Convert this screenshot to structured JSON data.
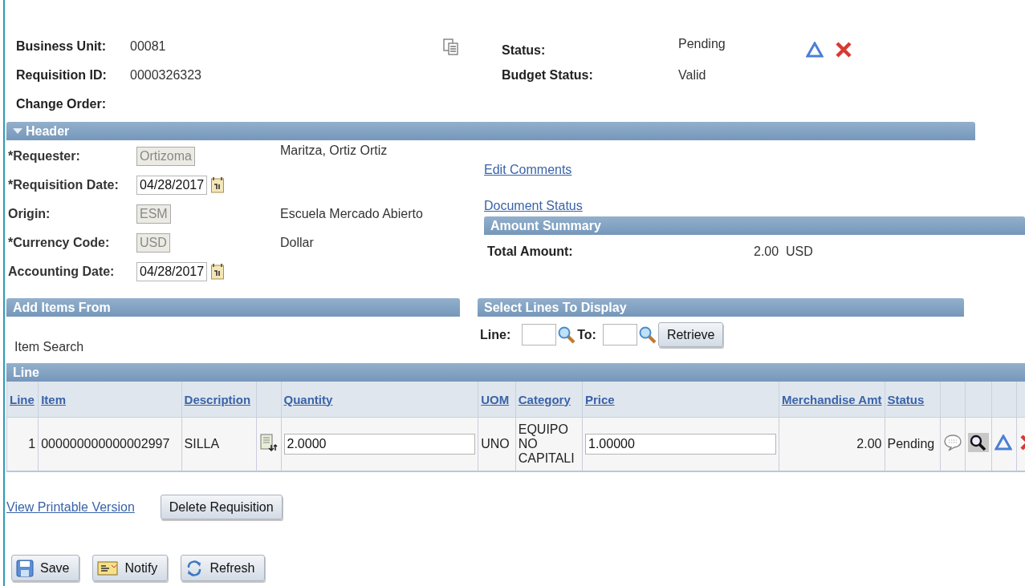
{
  "summary": {
    "fields": [
      {
        "label": "Business Unit:",
        "value": "00081"
      },
      {
        "label": "Requisition ID:",
        "value": "0000326323"
      },
      {
        "label": "Change Order:"
      }
    ],
    "status": [
      {
        "label": "Status:",
        "value": "Pending"
      },
      {
        "label": "Budget Status:",
        "value": "Valid"
      }
    ]
  },
  "header": {
    "title": "Header",
    "expanded": true,
    "fields": [
      {
        "label": "*Requester:",
        "value": "Ortizoma",
        "disabled": true,
        "kind": "text",
        "description": "Maritza, Ortiz Ortiz"
      },
      {
        "label": "*Requisition Date:",
        "value": "04/28/2017",
        "disabled": false,
        "kind": "date"
      },
      {
        "label": "Origin:",
        "value": "ESM",
        "disabled": true,
        "kind": "text",
        "description": "Escuela Mercado Abierto"
      },
      {
        "label": "*Currency Code:",
        "value": "USD",
        "disabled": true,
        "kind": "text",
        "description": "Dollar"
      },
      {
        "label": "Accounting Date:",
        "value": "04/28/2017",
        "disabled": false,
        "kind": "date"
      }
    ],
    "links": [
      "Edit Comments",
      "Document Status"
    ],
    "amount_summary": {
      "title": "Amount Summary",
      "label": "Total Amount:",
      "amount": "2.00",
      "currency": "USD"
    }
  },
  "add_items": {
    "title": "Add Items From",
    "link": "Item Search"
  },
  "select_lines": {
    "title": "Select Lines To Display",
    "from_label": "Line:",
    "to_label": "To:",
    "button": "Retrieve"
  },
  "lines": {
    "title": "Line",
    "columns": [
      {
        "label": "Line",
        "kind": "number"
      },
      {
        "label": "Item",
        "kind": "text"
      },
      {
        "label": "Description",
        "kind": "text"
      },
      {
        "kind": "lookup"
      },
      {
        "label": "Quantity",
        "kind": "input"
      },
      {
        "label": "UOM",
        "kind": "text"
      },
      {
        "label": "Category",
        "kind": "text"
      },
      {
        "label": "Price",
        "kind": "input"
      },
      {
        "label": "Merchandise Amt",
        "kind": "number"
      },
      {
        "label": "Status",
        "kind": "text"
      },
      {
        "kind": "comment"
      },
      {
        "kind": "details"
      },
      {
        "kind": "edit"
      },
      {
        "kind": "delete"
      }
    ],
    "rows": [
      {
        "cells": [
          "1",
          "000000000000002997",
          "SILLA",
          "",
          "2.0000",
          "UNO",
          "EQUIPO NO CAPITALI",
          "1.00000",
          "2.00",
          "Pending",
          "",
          "",
          "",
          ""
        ]
      }
    ]
  },
  "actions": {
    "link": "View Printable Version",
    "button": "Delete Requisition"
  },
  "buttons": [
    {
      "label": "Save",
      "kind": "save"
    },
    {
      "label": "Notify",
      "kind": "notify"
    },
    {
      "label": "Refresh",
      "kind": "refresh"
    }
  ]
}
